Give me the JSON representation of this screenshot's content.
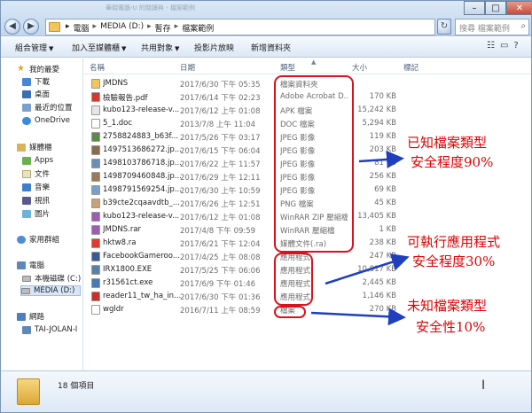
{
  "window": {
    "title_faint": "華碩電腦-U 的閱讀與 - 檔案範例",
    "controls": {
      "minimize": "–",
      "maximize": "□",
      "close": "✕"
    }
  },
  "address": {
    "crumbs": [
      "電腦",
      "MEDIA (D:)",
      "暫存",
      "檔案範例"
    ],
    "separator": "▸",
    "search_placeholder": "搜尋 檔案範例"
  },
  "toolbar": {
    "organize": "組合管理",
    "add_to_library": "加入至媒體櫃",
    "share": "共用對象",
    "slideshow": "投影片放映",
    "new_folder": "新增資料夾"
  },
  "nav": {
    "favorites": "我的最愛",
    "downloads": "下載",
    "desktop": "桌面",
    "recent": "最近的位置",
    "onedrive": "OneDrive",
    "libraries": "媒體櫃",
    "apps": "Apps",
    "documents": "文件",
    "music": "音樂",
    "videos": "視訊",
    "pictures": "圖片",
    "homegroup": "家用群組",
    "computer": "電腦",
    "local_disk": "本機磁碟 (C:)",
    "media_drive": "MEDIA (D:)",
    "network": "網路",
    "network_pc": "TAI-JOLAN-I"
  },
  "columns": {
    "name": "名稱",
    "date": "日期",
    "type": "類型",
    "size": "大小",
    "tags": "標記"
  },
  "files": [
    {
      "name": "JMDNS",
      "date": "2017/6/30 下午 05:35",
      "type": "檔案資料夾",
      "size": "",
      "icon_color": "#f2c55c"
    },
    {
      "name": "檢驗報告.pdf",
      "date": "2017/6/14 下午 02:23",
      "type": "Adobe Acrobat D...",
      "size": "170 KB",
      "icon_color": "#d23a2e"
    },
    {
      "name": "kubo123-release-v...",
      "date": "2017/6/12 上午 01:08",
      "type": "APK 檔案",
      "size": "15,242 KB",
      "icon_color": "#e6e6e6"
    },
    {
      "name": "5_1.doc",
      "date": "2013/7/8 上午 11:04",
      "type": "DOC 檔案",
      "size": "5,294 KB",
      "icon_color": "#ffffff"
    },
    {
      "name": "2758824883_b63f...",
      "date": "2017/5/26 下午 03:17",
      "type": "JPEG 影像",
      "size": "119 KB",
      "icon_color": "#5d8a4a"
    },
    {
      "name": "1497513686272.jp...",
      "date": "2017/6/15 下午 06:04",
      "type": "JPEG 影像",
      "size": "203 KB",
      "icon_color": "#8a6b4a"
    },
    {
      "name": "1498103786718.jp...",
      "date": "2017/6/22 上午 11:57",
      "type": "JPEG 影像",
      "size": "81 KB",
      "icon_color": "#6a8fb5"
    },
    {
      "name": "1498709460848.jp...",
      "date": "2017/6/29 上午 12:11",
      "type": "JPEG 影像",
      "size": "256 KB",
      "icon_color": "#9a7a5a"
    },
    {
      "name": "1498791569254.jp...",
      "date": "2017/6/30 上午 10:59",
      "type": "JPEG 影像",
      "size": "69 KB",
      "icon_color": "#7aa0c8"
    },
    {
      "name": "b39cte2cqaavdtb_...",
      "date": "2017/6/26 上午 12:51",
      "type": "PNG 檔案",
      "size": "45 KB",
      "icon_color": "#c8a07a"
    },
    {
      "name": "kubo123-release-v...",
      "date": "2017/6/12 上午 01:08",
      "type": "WinRAR ZIP 壓縮檔",
      "size": "13,405 KB",
      "icon_color": "#9b5fb0"
    },
    {
      "name": "JMDNS.rar",
      "date": "2017/4/8 下午 09:59",
      "type": "WinRAR 壓縮檔",
      "size": "1 KB",
      "icon_color": "#9b5fb0"
    },
    {
      "name": "hktw8.ra",
      "date": "2017/6/21 下午 12:04",
      "type": "媒體文件(.ra)",
      "size": "238 KB",
      "icon_color": "#e03a2e"
    },
    {
      "name": "FacebookGameroo...",
      "date": "2017/4/25 上午 08:08",
      "type": "應用程式",
      "size": "247 KB",
      "icon_color": "#3b5998"
    },
    {
      "name": "IRX1800.EXE",
      "date": "2017/5/25 下午 06:06",
      "type": "應用程式",
      "size": "10,817 KB",
      "icon_color": "#5a7fa8"
    },
    {
      "name": "r31561ct.exe",
      "date": "2017/6/9 下午 01:46",
      "type": "應用程式",
      "size": "2,445 KB",
      "icon_color": "#4a7ab0"
    },
    {
      "name": "reader11_tw_ha_in...",
      "date": "2017/6/30 下午 01:36",
      "type": "應用程式",
      "size": "1,146 KB",
      "icon_color": "#c8302a"
    },
    {
      "name": "wgldr",
      "date": "2016/7/11 上午 08:59",
      "type": "檔案",
      "size": "270 KB",
      "icon_color": "#ffffff"
    }
  ],
  "annotations": {
    "known_line1": "已知檔案類型",
    "known_line2": "安全程度90%",
    "exec_line1": "可執行應用程式",
    "exec_line2": "安全程度30%",
    "unknown_line1": "未知檔案類型",
    "unknown_line2": "安全性10%",
    "color": "#e00000",
    "arrow_color": "#1f3fbf"
  },
  "status": {
    "count_text": "18 個項目"
  }
}
